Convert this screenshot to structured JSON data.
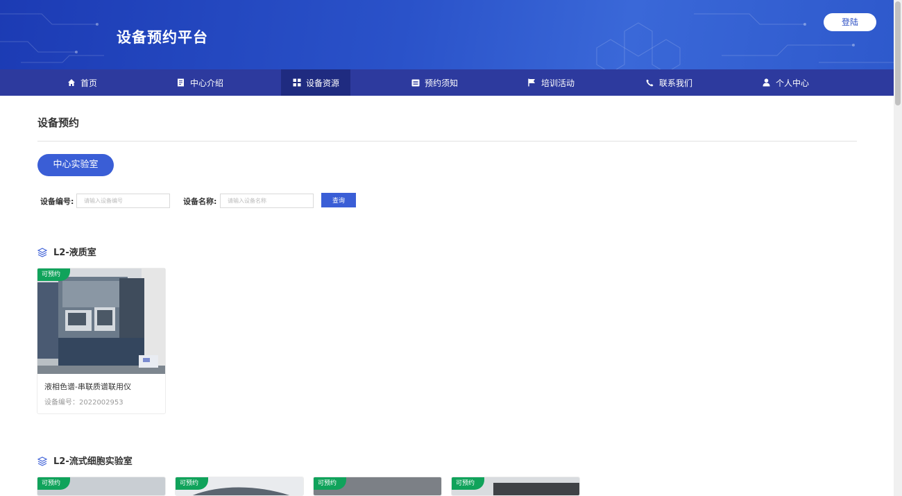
{
  "header": {
    "title": "设备预约平台",
    "login_label": "登陆"
  },
  "nav": {
    "items": [
      {
        "label": "首页",
        "icon": "home-icon"
      },
      {
        "label": "中心介绍",
        "icon": "document-icon"
      },
      {
        "label": "设备资源",
        "icon": "grid-icon",
        "active": true
      },
      {
        "label": "预约须知",
        "icon": "list-icon"
      },
      {
        "label": "培训活动",
        "icon": "flag-icon"
      },
      {
        "label": "联系我们",
        "icon": "phone-icon"
      },
      {
        "label": "个人中心",
        "icon": "user-icon"
      }
    ]
  },
  "main": {
    "title": "设备预约",
    "lab_filter": "中心实验室",
    "search": {
      "code_label": "设备编号:",
      "code_placeholder": "请输入设备编号",
      "name_label": "设备名称:",
      "name_placeholder": "请输入设备名称",
      "query_label": "查询"
    },
    "groups": [
      {
        "name": "L2-液质室",
        "devices": [
          {
            "tag": "可预约",
            "name": "液相色谱-串联质谱联用仪",
            "code_label": "设备编号：",
            "code": "2022002953"
          }
        ]
      },
      {
        "name": "L2-流式细胞实验室",
        "devices": [
          {
            "tag": "可预约"
          },
          {
            "tag": "可预约"
          },
          {
            "tag": "可预约"
          },
          {
            "tag": "可预约"
          }
        ]
      }
    ]
  },
  "colors": {
    "accent": "#3a5ed6",
    "nav_bg": "#2d3a9e",
    "nav_active": "#1f2b80",
    "tag_green": "#10a35b"
  }
}
